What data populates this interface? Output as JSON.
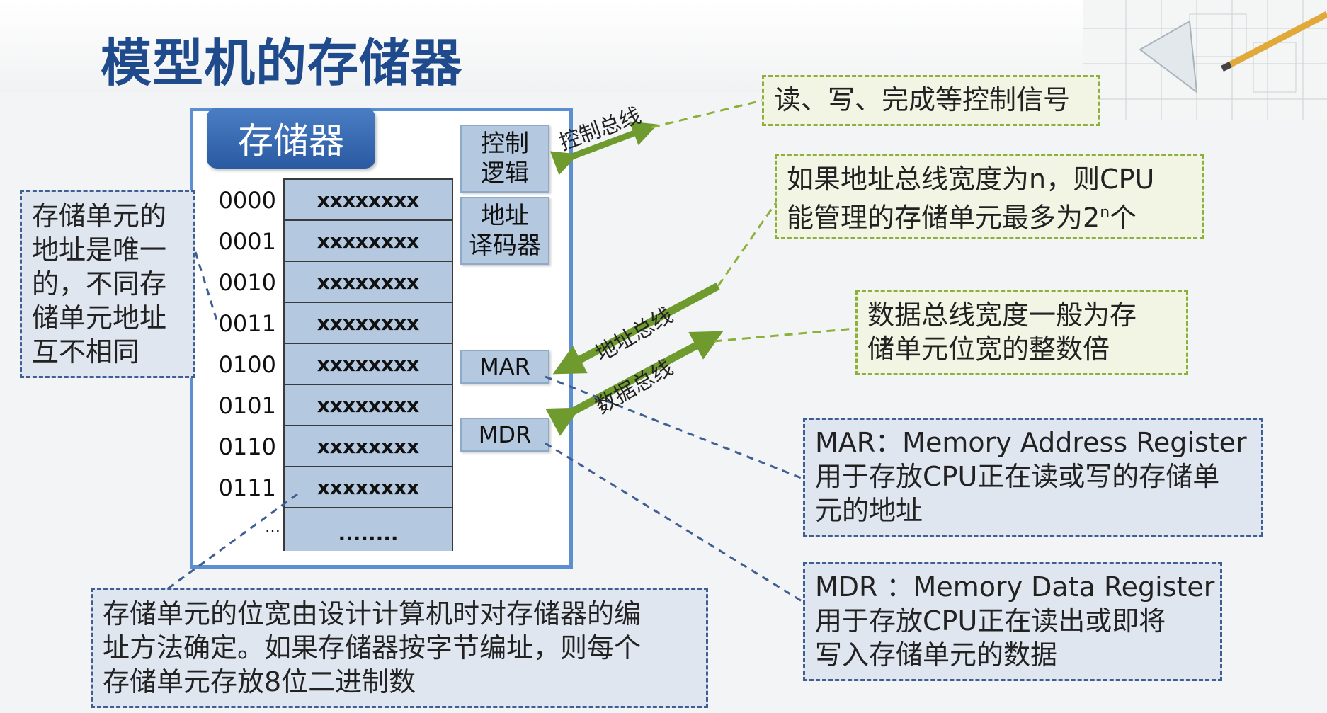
{
  "title": "模型机的存储器",
  "memory": {
    "label": "存储器",
    "addresses": [
      "0000",
      "0001",
      "0010",
      "0011",
      "0100",
      "0101",
      "0110",
      "0111",
      "…"
    ],
    "cells": [
      "xxxxxxxx",
      "xxxxxxxx",
      "xxxxxxxx",
      "xxxxxxxx",
      "xxxxxxxx",
      "xxxxxxxx",
      "xxxxxxxx",
      "xxxxxxxx",
      "........"
    ],
    "control_logic_line1": "控制",
    "control_logic_line2": "逻辑",
    "decoder_line1": "地址",
    "decoder_line2": "译码器",
    "mar": "MAR",
    "mdr": "MDR"
  },
  "buses": {
    "control": "控制总线",
    "address": "地址总线",
    "data": "数据总线"
  },
  "notes": {
    "control_signals": "读、写、完成等控制信号",
    "address_width_line1": "如果地址总线宽度为n，则CPU",
    "address_width_line2_pre": "能管理的存储单元最多为2",
    "address_width_sup": "n",
    "address_width_line2_post": "个",
    "data_width_line1": "数据总线宽度一般为存",
    "data_width_line2": "储单元位宽的整数倍",
    "unique_address": [
      "存储单元的",
      "地址是唯一",
      "的，不同存",
      "储单元地址",
      "互不相同"
    ],
    "bit_width_line1": "存储单元的位宽由设计计算机时对存储器的编",
    "bit_width_line2": "址方法确定。如果存储器按字节编址，则每个",
    "bit_width_line3": "存储单元存放8位二进制数",
    "mar_line1": "MAR：Memory Address Register",
    "mar_line2": "用于存放CPU正在读或写的存储单",
    "mar_line3": "元的地址",
    "mdr_line1": "MDR ：Memory Data Register",
    "mdr_line2": "用于存放CPU正在读出或即将",
    "mdr_line3": "写入存储单元的数据"
  },
  "colors": {
    "title": "#1f4a8c",
    "frame": "#5b8fd1",
    "cell": "#b4c8e0",
    "bus_arrow": "#6e9a2e",
    "green_dash": "#8bb13a",
    "blue_dash": "#3f5f94"
  }
}
